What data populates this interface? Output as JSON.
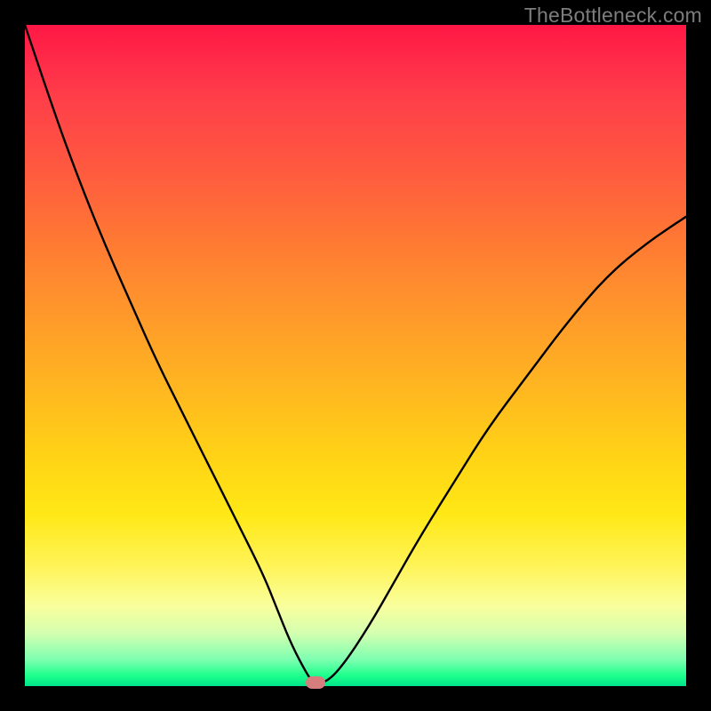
{
  "watermark": "TheBottleneck.com",
  "colors": {
    "frame": "#000000",
    "watermark": "#7d7d7d",
    "curve": "#000000",
    "marker": "#d67d7d",
    "gradient_top": "#ff1744",
    "gradient_bottom": "#00e38a"
  },
  "chart_data": {
    "type": "line",
    "title": "",
    "xlabel": "",
    "ylabel": "",
    "xlim": [
      0,
      100
    ],
    "ylim": [
      0,
      100
    ],
    "grid": false,
    "legend": false,
    "series": [
      {
        "name": "bottleneck-curve",
        "x": [
          0,
          4,
          8,
          12,
          16,
          20,
          24,
          28,
          32,
          36,
          38,
          40,
          42,
          43.5,
          45.5,
          48,
          52,
          56,
          60,
          65,
          70,
          76,
          82,
          88,
          94,
          100
        ],
        "y": [
          100,
          88,
          77,
          67,
          58,
          49,
          41,
          33,
          25,
          17,
          12,
          7,
          3,
          0.5,
          0.5,
          3,
          9,
          16,
          23,
          31,
          39,
          47,
          55,
          62,
          67,
          71
        ]
      }
    ],
    "annotations": [
      {
        "name": "optimal-marker",
        "x": 44,
        "y": 0.5
      }
    ]
  }
}
